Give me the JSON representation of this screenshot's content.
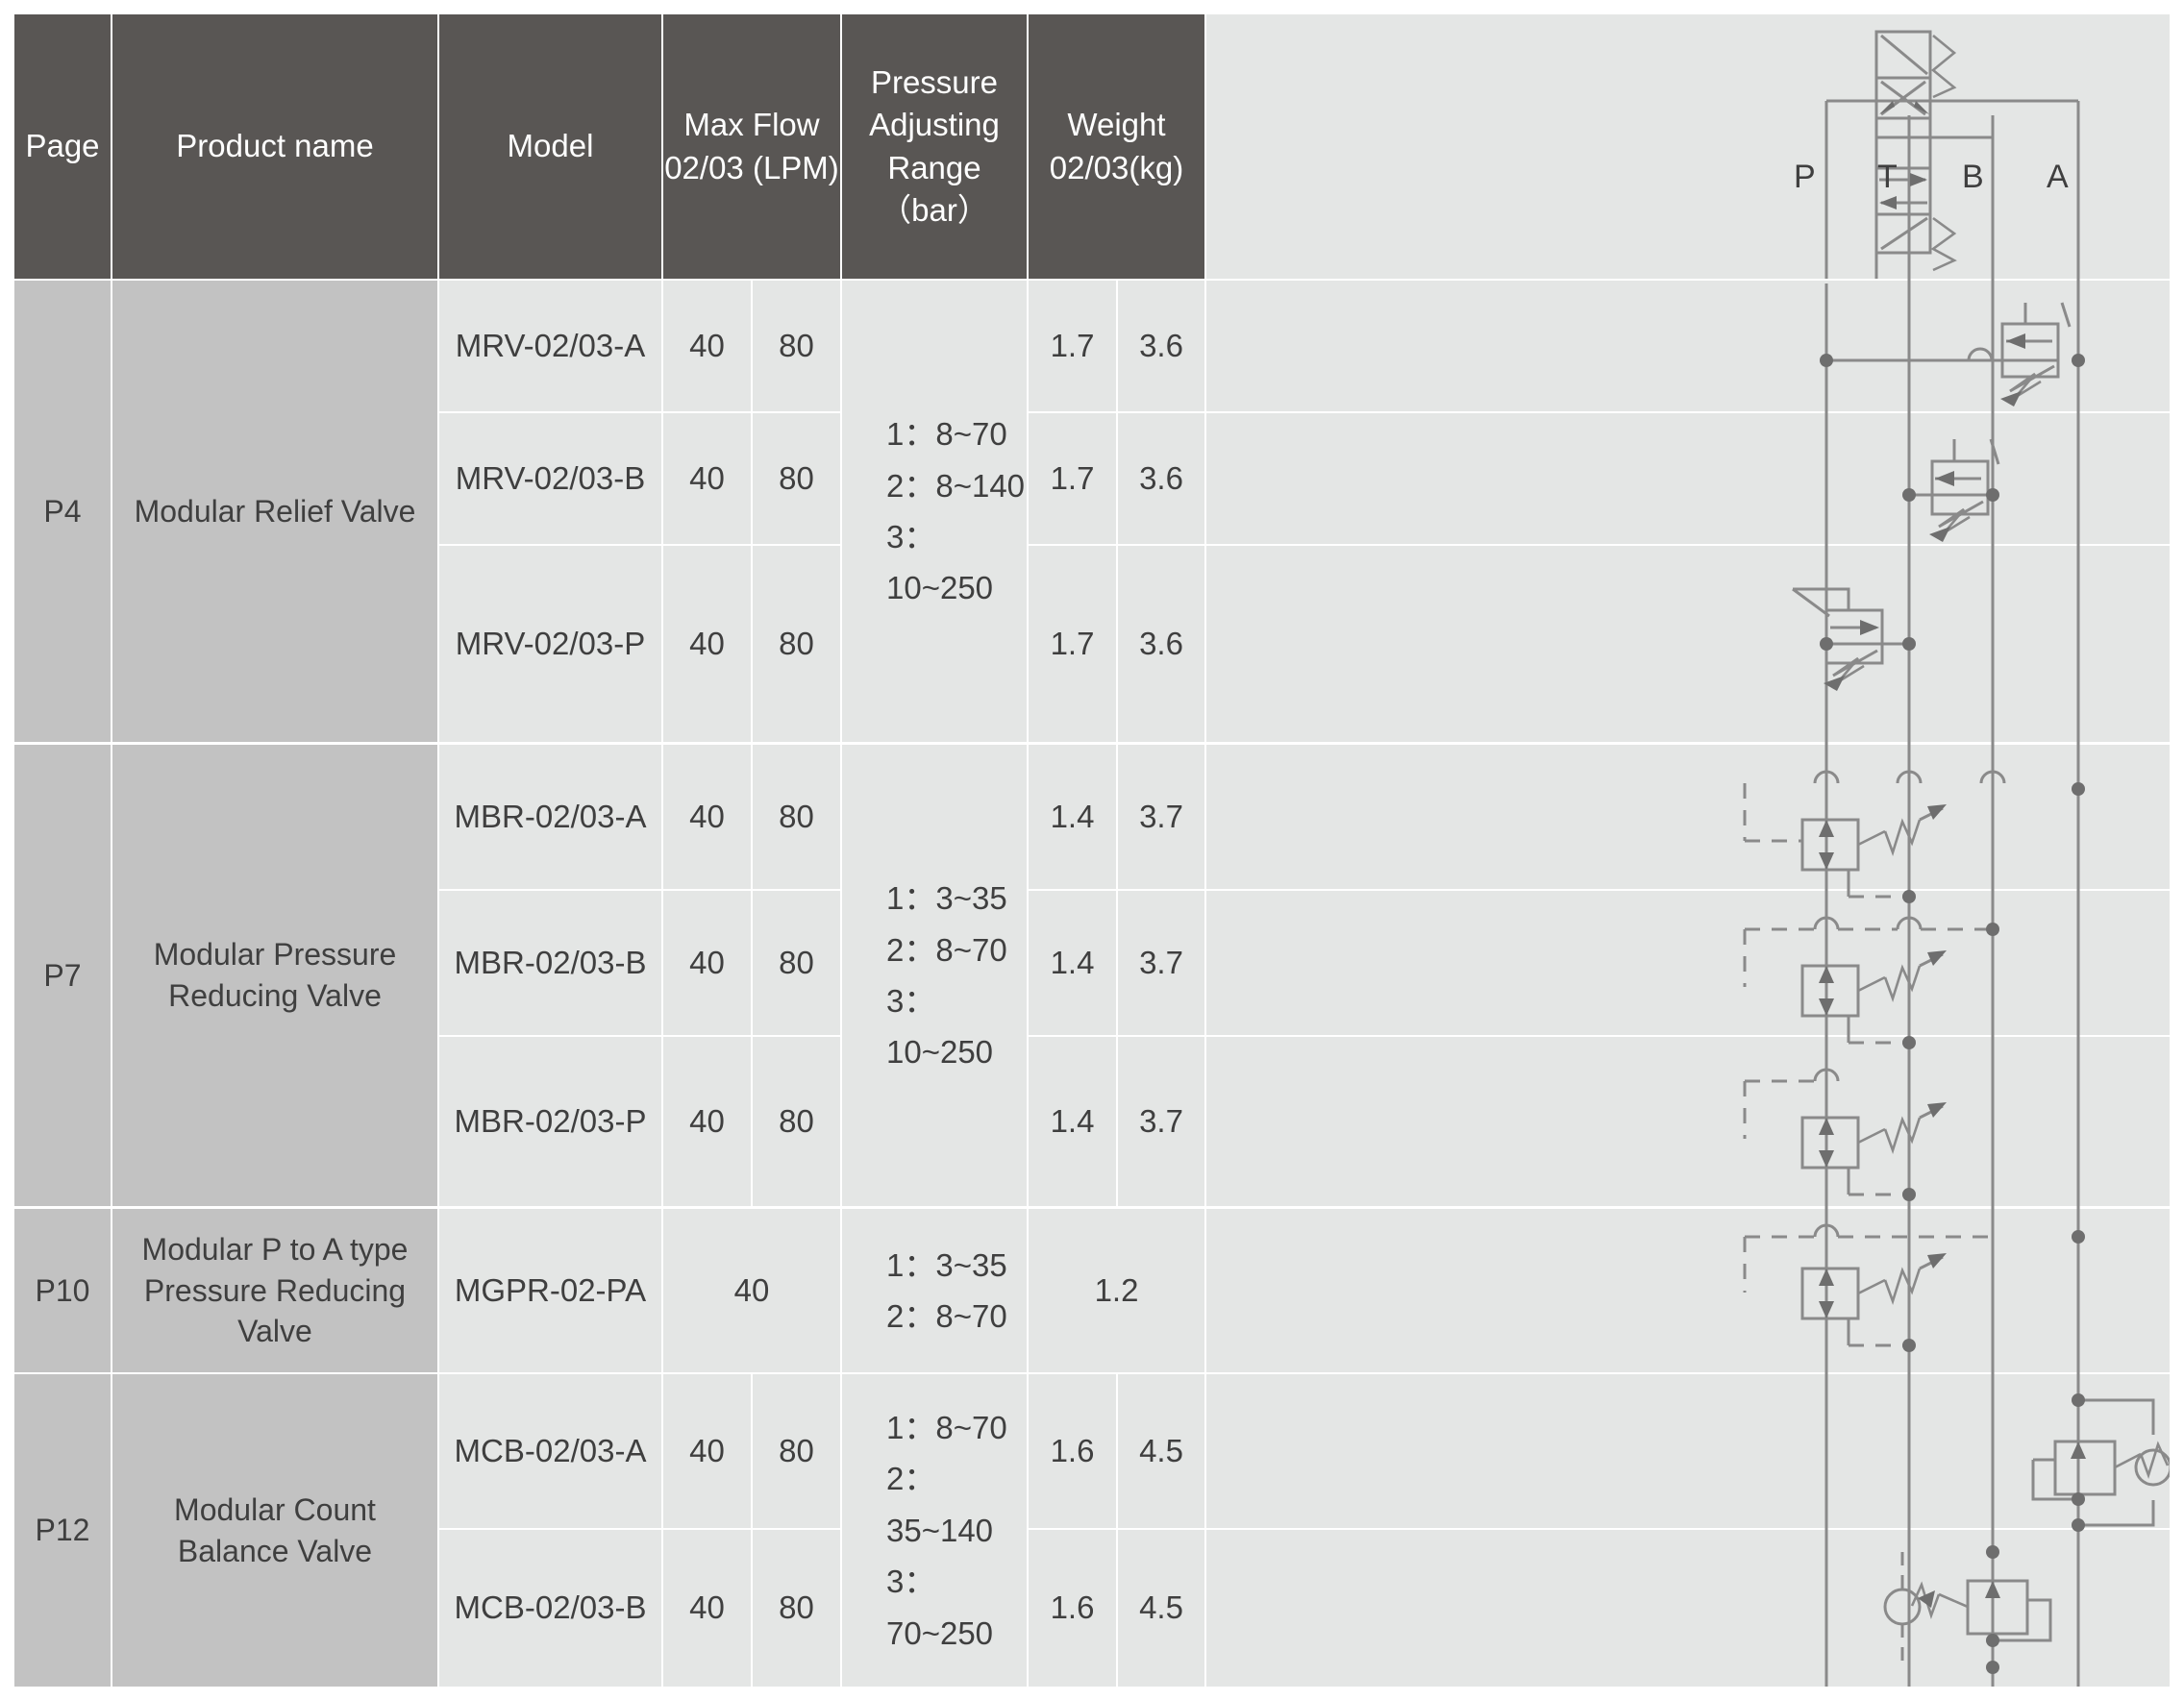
{
  "table": {
    "columns": [
      {
        "key": "page",
        "label": "Page"
      },
      {
        "key": "product",
        "label": "Product name"
      },
      {
        "key": "model",
        "label": "Model"
      },
      {
        "key": "flow",
        "label": "Max Flow\n02/03 (LPM)"
      },
      {
        "key": "pressure",
        "label": "Pressure\nAdjusting\nRange\n（bar）"
      },
      {
        "key": "weight",
        "label": "Weight\n02/03(kg)"
      },
      {
        "key": "symbol",
        "label": ""
      }
    ],
    "groups": [
      {
        "page": "P4",
        "product": "Modular Relief  Valve",
        "pressure": "1：8~70\n2：8~140\n3：10~250",
        "rows": [
          {
            "model": "MRV-02/03-A",
            "flow_02": "40",
            "flow_03": "80",
            "weight_02": "1.7",
            "weight_03": "3.6",
            "symbol": "relief-valve-a"
          },
          {
            "model": "MRV-02/03-B",
            "flow_02": "40",
            "flow_03": "80",
            "weight_02": "1.7",
            "weight_03": "3.6",
            "symbol": "relief-valve-b"
          },
          {
            "model": "MRV-02/03-P",
            "flow_02": "40",
            "flow_03": "80",
            "weight_02": "1.7",
            "weight_03": "3.6",
            "symbol": "relief-valve-p"
          }
        ]
      },
      {
        "page": "P7",
        "product": "Modular Pressure\nReducing Valve",
        "pressure": "1：3~35\n2：8~70\n3：10~250",
        "rows": [
          {
            "model": "MBR-02/03-A",
            "flow_02": "40",
            "flow_03": "80",
            "weight_02": "1.4",
            "weight_03": "3.7",
            "symbol": "reducing-valve-a"
          },
          {
            "model": "MBR-02/03-B",
            "flow_02": "40",
            "flow_03": "80",
            "weight_02": "1.4",
            "weight_03": "3.7",
            "symbol": "reducing-valve-b"
          },
          {
            "model": "MBR-02/03-P",
            "flow_02": "40",
            "flow_03": "80",
            "weight_02": "1.4",
            "weight_03": "3.7",
            "symbol": "reducing-valve-p"
          }
        ]
      },
      {
        "page": "P10",
        "product": "Modular P to A type\nPressure Reducing Valve",
        "pressure": "1：3~35\n2：8~70",
        "rows": [
          {
            "model": "MGPR-02-PA",
            "flow_span": "40",
            "weight_span": "1.2",
            "symbol": "reducing-valve-pa"
          }
        ]
      },
      {
        "page": "P12",
        "product": "Modular Count\nBalance Valve",
        "pressure": "1：8~70\n2：35~140\n3：70~250",
        "rows": [
          {
            "model": "MCB-02/03-A",
            "flow_02": "40",
            "flow_03": "80",
            "weight_02": "1.6",
            "weight_03": "4.5",
            "symbol": "counterbalance-valve-a"
          },
          {
            "model": "MCB-02/03-B",
            "flow_02": "40",
            "flow_03": "80",
            "weight_02": "1.6",
            "weight_03": "4.5",
            "symbol": "counterbalance-valve-b"
          }
        ]
      }
    ]
  },
  "symbol_header": {
    "ports": [
      "P",
      "T",
      "B",
      "A"
    ],
    "diagram_name": "directional-control-valve-symbol"
  },
  "colors": {
    "header_bg": "#595654",
    "header_text": "#ffffff",
    "group_bg": "#c2c2c2",
    "data_bg": "#e4e6e5",
    "text": "#3f3f3f",
    "line": "#8a8a8a",
    "page_bg": "#ffffff"
  }
}
